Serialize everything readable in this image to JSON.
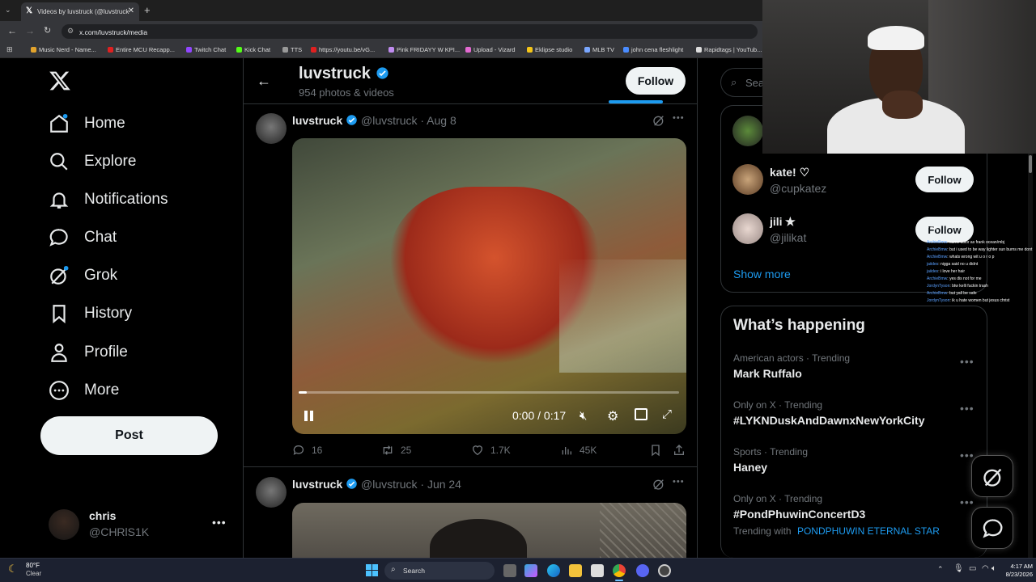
{
  "browser": {
    "tab_title": "Videos by luvstruck (@luvstruck",
    "url": "x.com/luvstruck/media",
    "bookmarks": [
      "Music Nerd - Name...",
      "Entire MCU Recapp...",
      "Twitch Chat",
      "Kick Chat",
      "TTS",
      "https://youtu.be/vG...",
      "Pink FRIDAYY W KPI...",
      "Upload - Vizard",
      "Eklipse studio",
      "MLB TV",
      "john cena fleshlight",
      "Rapidtags | YouTub..."
    ]
  },
  "nav": {
    "items": [
      "Home",
      "Explore",
      "Notifications",
      "Chat",
      "Grok",
      "History",
      "Profile",
      "More"
    ],
    "post_label": "Post",
    "account_name": "chris",
    "account_handle": "@CHRlS1K"
  },
  "header": {
    "name": "luvstruck",
    "count": "954 photos & videos",
    "follow_label": "Follow"
  },
  "posts": [
    {
      "name": "luvstruck",
      "handle": "@luvstruck",
      "date": "Aug 8",
      "time": "0:00 / 0:17",
      "replies": "16",
      "reposts": "25",
      "likes": "1.7K",
      "views": "45K"
    },
    {
      "name": "luvstruck",
      "handle": "@luvstruck",
      "date": "Jun 24"
    }
  ],
  "right": {
    "search_placeholder": "Sea",
    "suggestions": [
      {
        "name": "kate! ♡",
        "handle": "@cupkatez",
        "button": "Follow"
      },
      {
        "name": "jili ✭",
        "handle": "@jilikat",
        "button": "Follow"
      }
    ],
    "show_more": "Show more",
    "happening_title": "What’s happening",
    "trends": [
      {
        "category": "American actors · Trending",
        "name": "Mark Ruffalo"
      },
      {
        "category": "Only on X · Trending",
        "name": "#LYKNDuskAndDawnxNewYorkCity"
      },
      {
        "category": "Sports · Trending",
        "name": "Haney"
      },
      {
        "category": "Only on X · Trending",
        "name": "#PondPhuwinConcertD3"
      }
    ],
    "trending_with_label": "Trending with",
    "trending_with_value": "PONDPHUWIN ETERNAL STAR"
  },
  "overlay_chat": [
    {
      "user": "",
      "text": "~ egg"
    },
    {
      "user": "ArchieBmw",
      "text": ": same color as frank ocean/mbj"
    },
    {
      "user": "ArchieBmw",
      "text": ": but i used to be way lighter sun burns me dont"
    },
    {
      "user": "ArchieBmw",
      "text": ": whats wrong wit u o r o p"
    },
    {
      "user": "jaiides",
      "text": ": nigga said no u didnt"
    },
    {
      "user": "jaiides",
      "text": ": i love her hair"
    },
    {
      "user": "ArchieBmw",
      "text": ": yes dis not for me"
    },
    {
      "user": "JordynTyson",
      "text": ": btw kelli fuckin trash"
    },
    {
      "user": "ArchieBmw",
      "text": ": but yall be safe"
    },
    {
      "user": "JordynTyson",
      "text": ": ik u hate women but jesus christ"
    }
  ],
  "taskbar": {
    "temp": "80°F",
    "weather": "Clear",
    "search": "Search",
    "time": "4:17 AM",
    "date": "8/23/2026"
  }
}
